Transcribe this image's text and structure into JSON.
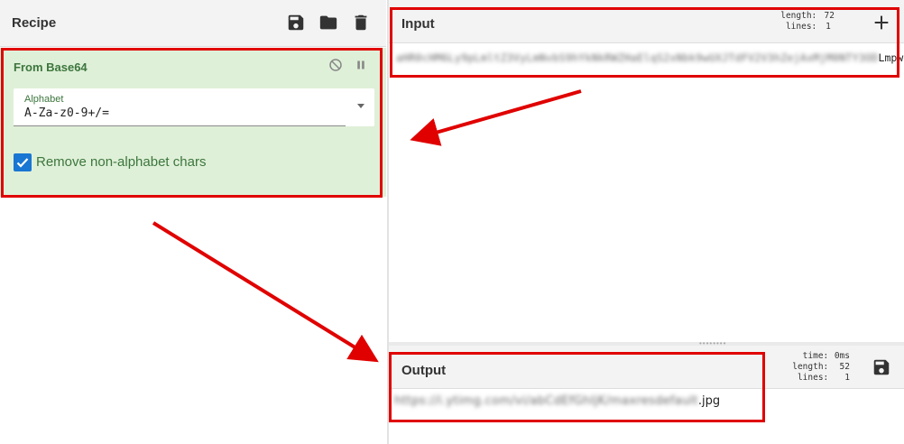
{
  "recipe": {
    "title": "Recipe",
    "icons": {
      "save": "save-icon",
      "open": "folder-icon",
      "clear": "trash-icon"
    }
  },
  "operation": {
    "title": "From Base64",
    "controls": {
      "disable": "disable-icon",
      "breakpoint": "pause-icon"
    },
    "alphabet": {
      "label": "Alphabet",
      "value": "A-Za-z0-9+/="
    },
    "remove_non_alphabet": {
      "label": "Remove non-alphabet chars",
      "checked": true
    }
  },
  "input": {
    "title": "Input",
    "stats": {
      "length_key": "length:",
      "length_val": "72",
      "lines_key": "lines:",
      "lines_val": "1"
    },
    "text_blurred": "aHR0cHM6Ly9pLmltZ3VyLmNvbS9hYkNkRWZHaElqS2xNbk9wUXJTdFV2V3hZejAxMjM0NTY3OD",
    "text_visible": "LmpwZw=="
  },
  "output": {
    "title": "Output",
    "stats": {
      "time_key": "time:",
      "time_val": "0ms",
      "length_key": "length:",
      "length_val": "52",
      "lines_key": "lines:",
      "lines_val": "1"
    },
    "text_blurred": "https://i.ytimg.com/vi/abCdEfGhIjK/maxresdefault",
    "text_visible": ".jpg"
  },
  "colors": {
    "accent_green": "#3c763d",
    "op_background": "#dff0d8",
    "checkbox_blue": "#1976d2",
    "annotation_red": "#e00000"
  }
}
